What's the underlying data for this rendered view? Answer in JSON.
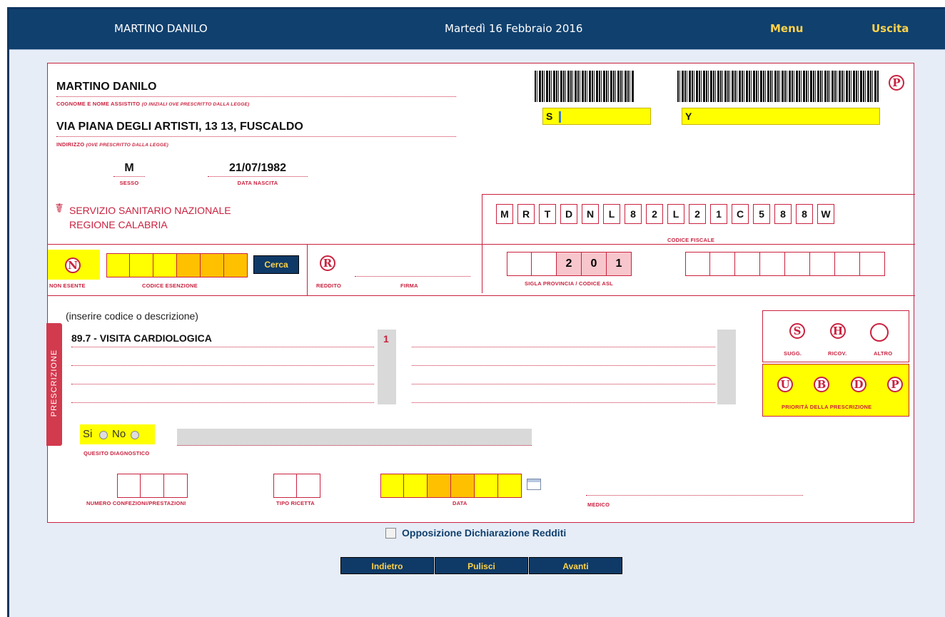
{
  "header": {
    "user_name": "MARTINO DANILO",
    "date": "Martedì 16 Febbraio 2016",
    "menu_label": "Menu",
    "exit_label": "Uscita"
  },
  "patient": {
    "name": "MARTINO DANILO",
    "name_caption": "COGNOME E NOME ASSISTITO",
    "name_caption_note": "(O INIZIALI OVE PRESCRITTO DALLA LEGGE)",
    "address": "VIA PIANA DEGLI ARTISTI, 13 13, FUSCALDO",
    "address_caption": "INDIRIZZO",
    "address_caption_note": "(OVE PRESCRITTO DALLA LEGGE)",
    "sex": "M",
    "sex_caption": "SESSO",
    "birth_date": "21/07/1982",
    "birth_caption": "DATA NASCITA"
  },
  "barcodes": {
    "s_label": "S",
    "y_label": "Y",
    "p_badge": "P"
  },
  "ssn": {
    "line1": "SERVIZIO SANITARIO NAZIONALE",
    "line2": "REGIONE CALABRIA"
  },
  "codice_fiscale": {
    "chars": [
      "M",
      "R",
      "T",
      "D",
      "N",
      "L",
      "8",
      "2",
      "L",
      "2",
      "1",
      "C",
      "5",
      "8",
      "8",
      "W"
    ],
    "caption": "CODICE FISCALE"
  },
  "esenzione": {
    "n_badge": "N",
    "non_esente": "NON ESENTE",
    "caption": "CODICE ESENZIONE",
    "search_button": "Cerca",
    "r_badge": "R",
    "reddito": "REDDITO",
    "firma": "FIRMA"
  },
  "asl": {
    "codes": [
      "2",
      "0",
      "1"
    ],
    "caption": "SIGLA PROVINCIA / CODICE ASL"
  },
  "prescrizione": {
    "tab_label": "PRESCRIZIONE",
    "hint": "(inserire codice o descrizione)",
    "rows": [
      {
        "desc": "89.7 - VISITA CARDIOLOGICA",
        "qty": "1"
      },
      {
        "desc": "",
        "qty": ""
      },
      {
        "desc": "",
        "qty": ""
      },
      {
        "desc": "",
        "qty": ""
      }
    ]
  },
  "badges": {
    "s": "S",
    "h": "H",
    "sugg": "SUGG.",
    "ricov": "RICOV.",
    "altro": "ALTRO",
    "u": "U",
    "b": "B",
    "d": "D",
    "p": "P",
    "priority_caption": "PRIORITÀ DELLA PRESCRIZIONE"
  },
  "quesito": {
    "si": "Si",
    "no": "No",
    "caption": "QUESITO DIAGNOSTICO"
  },
  "footer_fields": {
    "numero_caption": "NUMERO CONFEZIONI/PRESTAZIONI",
    "tipo_caption": "TIPO RICETTA",
    "data_caption": "DATA",
    "medico_caption": "MEDICO"
  },
  "opposizione": "Opposizione Dichiarazione Redditi",
  "buttons": {
    "back": "Indietro",
    "clear": "Pulisci",
    "next": "Avanti"
  }
}
